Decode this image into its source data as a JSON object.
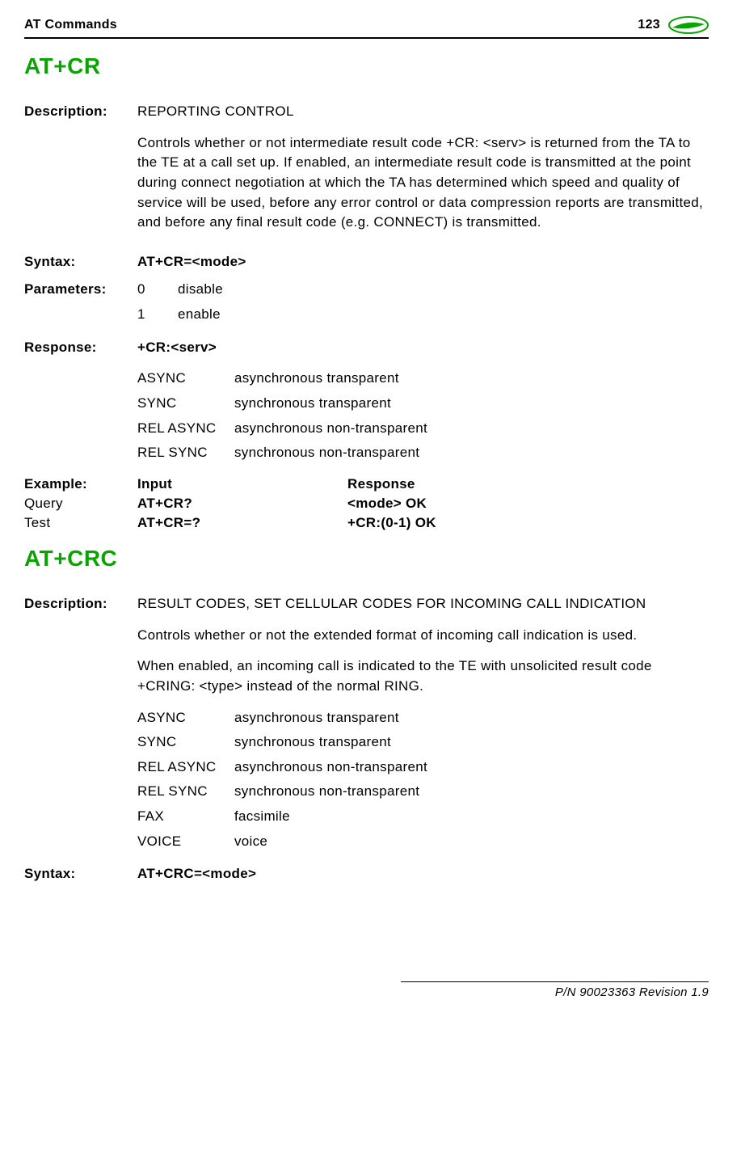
{
  "header": {
    "left": "AT Commands",
    "page": "123"
  },
  "cmd1": {
    "title": "AT+CR",
    "description_label": "Description:",
    "desc_title": "REPORTING CONTROL",
    "desc_body": "Controls whether or not intermediate result code +CR: <serv> is returned from the TA to the TE at a call set up. If enabled, an intermediate result code is transmitted at the point during connect negotiation at which the TA has determined which speed and quality of service will be used, before any error control or data compression reports are transmitted, and before any final result code (e.g. CONNECT) is transmitted.",
    "syntax_label": "Syntax:",
    "syntax_value": "AT+CR=<mode>",
    "params_label": "Parameters:",
    "params": [
      {
        "k": "0",
        "v": "disable"
      },
      {
        "k": "1",
        "v": "enable"
      }
    ],
    "response_label": "Response:",
    "response_head": "+CR:<serv>",
    "serv": [
      {
        "k": "ASYNC",
        "v": "asynchronous transparent"
      },
      {
        "k": "SYNC",
        "v": "synchronous transparent"
      },
      {
        "k": "REL ASYNC",
        "v": "asynchronous non-transparent"
      },
      {
        "k": "REL SYNC",
        "v": "synchronous non-transparent"
      }
    ],
    "example_label": "Example:",
    "example_input_hdr": "Input",
    "example_response_hdr": "Response",
    "examples": [
      {
        "label": "Query",
        "input": "AT+CR?",
        "response": "<mode> OK"
      },
      {
        "label": "Test",
        "input": "AT+CR=?",
        "response": "+CR:(0-1) OK"
      }
    ]
  },
  "cmd2": {
    "title": "AT+CRC",
    "description_label": "Description:",
    "desc_title": "RESULT CODES, SET CELLULAR CODES FOR INCOMING CALL INDICATION",
    "desc_p1": "Controls whether or not the extended format of incoming call indication is used.",
    "desc_p2": "When enabled, an incoming call is indicated to the TE with unsolicited result code +CRING: <type> instead of the normal RING.",
    "types": [
      {
        "k": "ASYNC",
        "v": "asynchronous transparent"
      },
      {
        "k": "SYNC",
        "v": "synchronous transparent"
      },
      {
        "k": "REL ASYNC",
        "v": "asynchronous non-transparent"
      },
      {
        "k": "REL SYNC",
        "v": "synchronous non-transparent"
      },
      {
        "k": "FAX",
        "v": "facsimile"
      },
      {
        "k": "VOICE",
        "v": "voice"
      }
    ],
    "syntax_label": "Syntax:",
    "syntax_value": "AT+CRC=<mode>"
  },
  "footer": "P/N 90023363  Revision 1.9"
}
